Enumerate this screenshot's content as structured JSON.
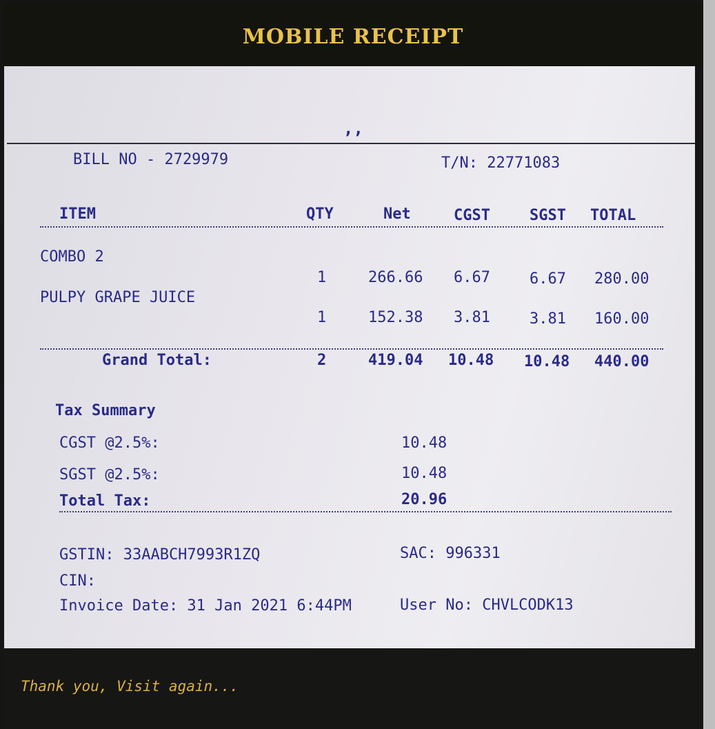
{
  "header": {
    "title": "MOBILE RECEIPT"
  },
  "receipt": {
    "top_mark": ",,",
    "bill_no": "BILL NO - 2729979",
    "tn": "T/N: 22771083",
    "columns": [
      "ITEM",
      "QTY",
      "Net",
      "CGST",
      "SGST",
      "TOTAL"
    ],
    "items": [
      {
        "name": "COMBO 2",
        "qty": "1",
        "net": "266.66",
        "cgst": "6.67",
        "sgst": "6.67",
        "total": "280.00"
      },
      {
        "name": "PULPY GRAPE JUICE",
        "qty": "1",
        "net": "152.38",
        "cgst": "3.81",
        "sgst": "3.81",
        "total": "160.00"
      }
    ],
    "grand_total": {
      "label": "Grand Total:",
      "qty": "2",
      "net": "419.04",
      "cgst": "10.48",
      "sgst": "10.48",
      "total": "440.00"
    },
    "tax_summary": {
      "title": "Tax Summary",
      "rows": [
        {
          "label": "CGST @2.5%:",
          "value": "10.48"
        },
        {
          "label": "SGST @2.5%:",
          "value": "10.48"
        },
        {
          "label": "Total Tax:",
          "value": "20.96"
        }
      ]
    },
    "info": {
      "gstin": "GSTIN: 33AABCH7993R1ZQ",
      "sac": "SAC: 996331",
      "cin": "CIN:",
      "invoice_date": "Invoice Date: 31 Jan 2021 6:44PM",
      "user_no": "User No: CHVLCODK13"
    }
  },
  "footer": {
    "message": "Thank you, Visit again..."
  }
}
